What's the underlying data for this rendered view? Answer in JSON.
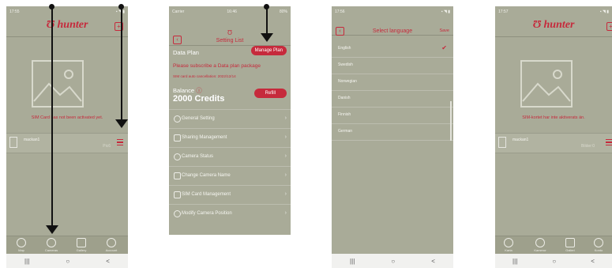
{
  "screen1": {
    "status_time": "17:55",
    "logo": "hunter",
    "warning": "SIM Card has not been activated yet.",
    "camera_name": "mackan1",
    "camera_value": "Pic6",
    "tabs": [
      "Map",
      "Cameras",
      "Gallery",
      "Account"
    ]
  },
  "screen2": {
    "status_left": "Carrier",
    "status_time": "16:46",
    "status_batt": "80%",
    "title": "Setting List",
    "data_plan": "Data Plan",
    "manage_plan": "Manage Plan",
    "subscribe": "Please subscribe a Data plan package",
    "sim_cancel": "SIM card auto cancellation:  2022/12/14",
    "balance": "Balance",
    "credits": "2000 Credits",
    "refill": "Refill",
    "menu": [
      "General Setting",
      "Sharing Management",
      "Camera Status",
      "Change Camera Name",
      "SIM Card Management",
      "Modify Camera Position"
    ]
  },
  "screen3": {
    "status_time": "17:56",
    "title": "Select language",
    "save": "Save",
    "languages": [
      "English",
      "Swedish",
      "Norwegian",
      "Danish",
      "Finnish",
      "German"
    ],
    "selected": "English"
  },
  "screen4": {
    "status_time": "17:57",
    "logo": "hunter",
    "warning": "SIM-kortet har inte aktiverats än.",
    "camera_name": "mackan1",
    "camera_value": "Bilder:0",
    "tabs": [
      "Karta",
      "Kameror",
      "Galleri",
      "Konto"
    ]
  },
  "nav_keys": [
    "|||",
    "○",
    "<"
  ],
  "colors": {
    "accent": "#c62a3c",
    "screen_bg": "#a9ab98"
  }
}
